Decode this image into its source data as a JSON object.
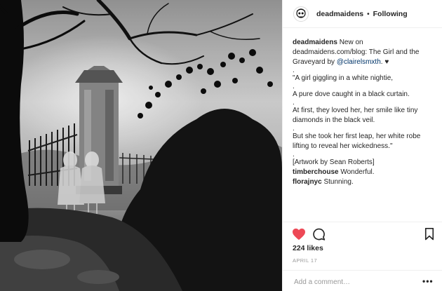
{
  "post": {
    "username": "deadmaidens",
    "separator": "•",
    "follow_status": "Following"
  },
  "caption": {
    "username": "deadmaidens",
    "intro": "New on deadmaidens.com/blog: The Girl and the Graveyard by",
    "mention": "@clairelsmxth",
    "heart": "♥",
    "dot": ".",
    "lines": [
      "\"A girl giggling in a white nightie,",
      "A pure dove caught in a black curtain.",
      "At first, they loved her, her smile like tiny diamonds in the black veil.",
      "But she took her first leap, her white robe lifting to reveal her wickedness.\""
    ],
    "credit": "[Artwork by Sean Roberts]"
  },
  "comments": [
    {
      "username": "timberchouse",
      "text": "Wonderful."
    },
    {
      "username": "florajnyc",
      "text": "Stunning."
    }
  ],
  "likes": "224 likes",
  "date": "APRIL 17",
  "add_comment": {
    "placeholder": "Add a comment…",
    "more": "•••"
  },
  "colors": {
    "like_red": "#ed4956",
    "text": "#262626",
    "muted": "#999999",
    "link": "#003569"
  },
  "icons": {
    "avatar": "skull-avatar",
    "like": "heart-icon",
    "comment": "speech-bubble-icon",
    "save": "bookmark-icon"
  }
}
